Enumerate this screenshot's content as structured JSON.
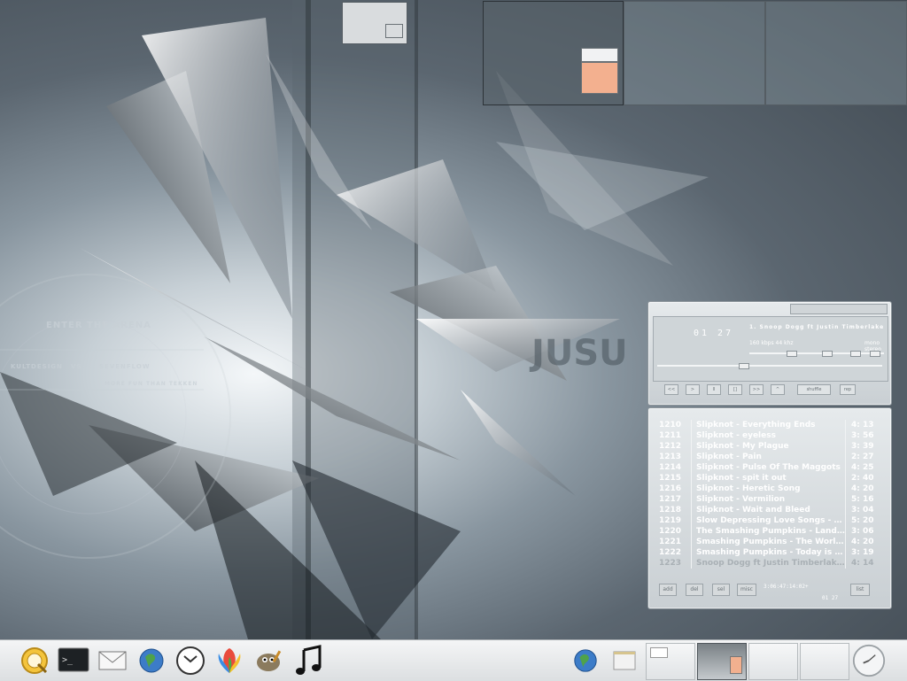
{
  "wallpaper": {
    "texts": [
      "ENTER THE ARENA",
      "KULTDESIGN",
      "VS",
      "SEVENFLOW",
      "MORE FUN THAN TEKKEN"
    ]
  },
  "player": {
    "time": "01 27",
    "title": "1. Snoop Dogg ft Justin Timberlake",
    "kbps": "160",
    "khz": "44",
    "kbps_unit": "kbps",
    "khz_unit": "khz",
    "mono_label": "mono",
    "stereo_label": "stereo",
    "buttons": [
      "<<",
      ">",
      "II",
      "[]",
      ">>",
      "^",
      "shuffle",
      "rep"
    ],
    "playlist": [
      {
        "num": "1210",
        "name": "Slipknot - Everything Ends",
        "len": "4: 13"
      },
      {
        "num": "1211",
        "name": "Slipknot - eyeless",
        "len": "3: 56"
      },
      {
        "num": "1212",
        "name": "Slipknot - My Plague",
        "len": "3: 39"
      },
      {
        "num": "1213",
        "name": "Slipknot - Pain",
        "len": "2: 27"
      },
      {
        "num": "1214",
        "name": "Slipknot - Pulse Of The Maggots",
        "len": "4: 25"
      },
      {
        "num": "1215",
        "name": "Slipknot - spit it out",
        "len": "2: 40"
      },
      {
        "num": "1216",
        "name": "Slipknot - Heretic Song",
        "len": "4: 20"
      },
      {
        "num": "1217",
        "name": "Slipknot - Vermilion",
        "len": "5: 16"
      },
      {
        "num": "1218",
        "name": "Slipknot - Wait and Bleed",
        "len": "3: 04"
      },
      {
        "num": "1219",
        "name": "Slow Depressing Love Songs - RE...",
        "len": "5: 20"
      },
      {
        "num": "1220",
        "name": "The Smashing Pumpkins - Lands...",
        "len": "3: 06"
      },
      {
        "num": "1221",
        "name": "Smashing Pumpkins - The World...",
        "len": "4: 20"
      },
      {
        "num": "1222",
        "name": "Smashing Pumpkins - Today is t...",
        "len": "3: 19"
      },
      {
        "num": "1223",
        "name": "Snoop Dogg ft Justin Timberlak...",
        "len": "4: 14"
      }
    ],
    "pl_buttons": [
      "add",
      "del",
      "sel",
      "misc",
      "list"
    ],
    "pl_total": "3:06:47:14:02+",
    "pl_time": "01 27"
  },
  "taskbar": {
    "launchers": [
      "menu-icon",
      "terminal-icon",
      "mail-icon",
      "browser-icon",
      "clock-app-icon",
      "messenger-icon",
      "gimp-icon",
      "music-icon"
    ],
    "tray": [
      "network-icon",
      "show-desktop-icon"
    ],
    "desktops": 4,
    "active_desktop": 2
  }
}
